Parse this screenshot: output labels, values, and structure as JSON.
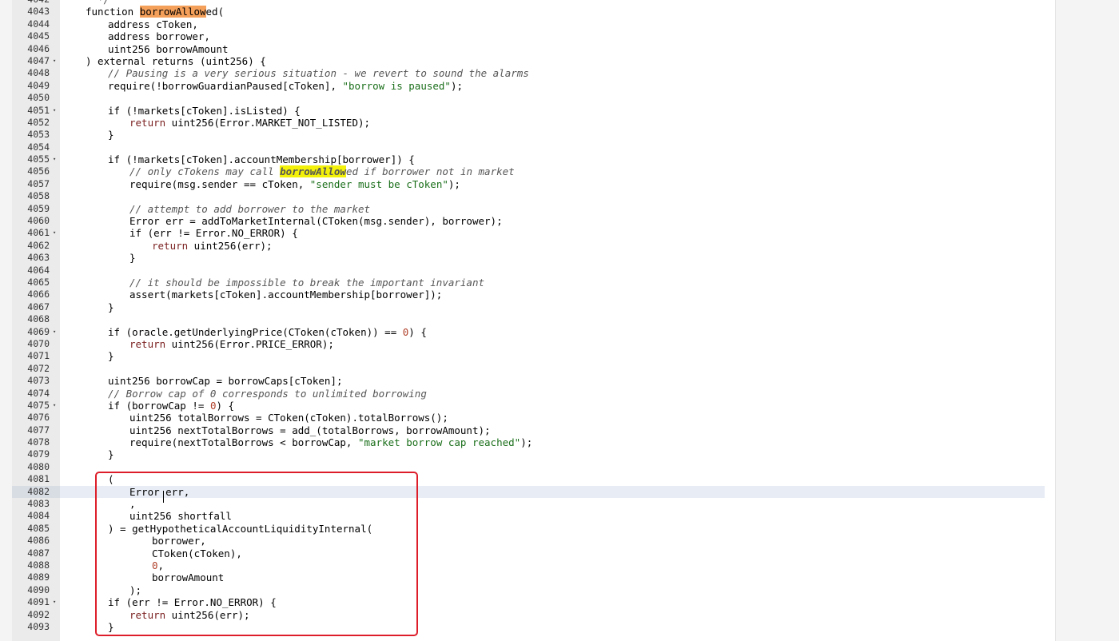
{
  "editor": {
    "highlight_colors": {
      "orange": "#f5a05a",
      "yellow": "#f3f10a",
      "annotation_box": "#dd1e2a",
      "active_line": "#e8edf5"
    },
    "active_line_number": "4082",
    "lines": [
      {
        "n": "4042",
        "fold": false,
        "indent": 0,
        "tokens": [
          {
            "t": "  */",
            "c": "comment"
          }
        ]
      },
      {
        "n": "4043",
        "fold": false,
        "indent": 0,
        "tokens": [
          {
            "t": "function "
          },
          {
            "t": "borrowAllow",
            "hl": "orange"
          },
          {
            "t": "ed("
          }
        ]
      },
      {
        "n": "4044",
        "fold": false,
        "indent": 1,
        "tokens": [
          {
            "t": "address cToken,"
          }
        ]
      },
      {
        "n": "4045",
        "fold": false,
        "indent": 1,
        "tokens": [
          {
            "t": "address borrower,"
          }
        ]
      },
      {
        "n": "4046",
        "fold": false,
        "indent": 1,
        "tokens": [
          {
            "t": "uint256 borrowAmount"
          }
        ]
      },
      {
        "n": "4047",
        "fold": true,
        "indent": 0,
        "tokens": [
          {
            "t": ") external returns (uint256) {"
          }
        ]
      },
      {
        "n": "4048",
        "fold": false,
        "indent": 1,
        "tokens": [
          {
            "t": "// Pausing is a very serious situation - we revert to sound the alarms",
            "c": "comment"
          }
        ]
      },
      {
        "n": "4049",
        "fold": false,
        "indent": 1,
        "tokens": [
          {
            "t": "require(!borrowGuardianPaused[cToken], "
          },
          {
            "t": "\"borrow is paused\"",
            "c": "string"
          },
          {
            "t": ");"
          }
        ]
      },
      {
        "n": "4050",
        "fold": false,
        "indent": 0,
        "tokens": []
      },
      {
        "n": "4051",
        "fold": true,
        "indent": 1,
        "tokens": [
          {
            "t": "if (!markets[cToken].isListed) {"
          }
        ]
      },
      {
        "n": "4052",
        "fold": false,
        "indent": 2,
        "tokens": [
          {
            "t": "return",
            "c": "kw"
          },
          {
            "t": " uint256(Error.MARKET_NOT_LISTED);"
          }
        ]
      },
      {
        "n": "4053",
        "fold": false,
        "indent": 1,
        "tokens": [
          {
            "t": "}"
          }
        ]
      },
      {
        "n": "4054",
        "fold": false,
        "indent": 0,
        "tokens": []
      },
      {
        "n": "4055",
        "fold": true,
        "indent": 1,
        "tokens": [
          {
            "t": "if (!markets[cToken].accountMembership[borrower]) {"
          }
        ]
      },
      {
        "n": "4056",
        "fold": false,
        "indent": 2,
        "tokens": [
          {
            "t": "// only cTokens may call ",
            "c": "comment"
          },
          {
            "t": "borrowAllow",
            "hl": "yellow",
            "c": "comment"
          },
          {
            "t": "ed if borrower not in market",
            "c": "comment"
          }
        ]
      },
      {
        "n": "4057",
        "fold": false,
        "indent": 2,
        "tokens": [
          {
            "t": "require(msg.sender == cToken, "
          },
          {
            "t": "\"sender must be cToken\"",
            "c": "string"
          },
          {
            "t": ");"
          }
        ]
      },
      {
        "n": "4058",
        "fold": false,
        "indent": 0,
        "tokens": []
      },
      {
        "n": "4059",
        "fold": false,
        "indent": 2,
        "tokens": [
          {
            "t": "// attempt to add borrower to the market",
            "c": "comment"
          }
        ]
      },
      {
        "n": "4060",
        "fold": false,
        "indent": 2,
        "tokens": [
          {
            "t": "Error err = addToMarketInternal(CToken(msg.sender), borrower);"
          }
        ]
      },
      {
        "n": "4061",
        "fold": true,
        "indent": 2,
        "tokens": [
          {
            "t": "if (err != Error.NO_ERROR) {"
          }
        ]
      },
      {
        "n": "4062",
        "fold": false,
        "indent": 3,
        "tokens": [
          {
            "t": "return",
            "c": "kw"
          },
          {
            "t": " uint256(err);"
          }
        ]
      },
      {
        "n": "4063",
        "fold": false,
        "indent": 2,
        "tokens": [
          {
            "t": "}"
          }
        ]
      },
      {
        "n": "4064",
        "fold": false,
        "indent": 0,
        "tokens": []
      },
      {
        "n": "4065",
        "fold": false,
        "indent": 2,
        "tokens": [
          {
            "t": "// it should be impossible to break the important invariant",
            "c": "comment"
          }
        ]
      },
      {
        "n": "4066",
        "fold": false,
        "indent": 2,
        "tokens": [
          {
            "t": "assert(markets[cToken].accountMembership[borrower]);"
          }
        ]
      },
      {
        "n": "4067",
        "fold": false,
        "indent": 1,
        "tokens": [
          {
            "t": "}"
          }
        ]
      },
      {
        "n": "4068",
        "fold": false,
        "indent": 0,
        "tokens": []
      },
      {
        "n": "4069",
        "fold": true,
        "indent": 1,
        "tokens": [
          {
            "t": "if (oracle.getUnderlyingPrice(CToken(cToken)) == "
          },
          {
            "t": "0",
            "c": "num"
          },
          {
            "t": ") {"
          }
        ]
      },
      {
        "n": "4070",
        "fold": false,
        "indent": 2,
        "tokens": [
          {
            "t": "return",
            "c": "kw"
          },
          {
            "t": " uint256(Error.PRICE_ERROR);"
          }
        ]
      },
      {
        "n": "4071",
        "fold": false,
        "indent": 1,
        "tokens": [
          {
            "t": "}"
          }
        ]
      },
      {
        "n": "4072",
        "fold": false,
        "indent": 0,
        "tokens": []
      },
      {
        "n": "4073",
        "fold": false,
        "indent": 1,
        "tokens": [
          {
            "t": "uint256 borrowCap = borrowCaps[cToken];"
          }
        ]
      },
      {
        "n": "4074",
        "fold": false,
        "indent": 1,
        "tokens": [
          {
            "t": "// Borrow cap of 0 corresponds to unlimited borrowing",
            "c": "comment"
          }
        ]
      },
      {
        "n": "4075",
        "fold": true,
        "indent": 1,
        "tokens": [
          {
            "t": "if (borrowCap != "
          },
          {
            "t": "0",
            "c": "num"
          },
          {
            "t": ") {"
          }
        ]
      },
      {
        "n": "4076",
        "fold": false,
        "indent": 2,
        "tokens": [
          {
            "t": "uint256 totalBorrows = CToken(cToken).totalBorrows();"
          }
        ]
      },
      {
        "n": "4077",
        "fold": false,
        "indent": 2,
        "tokens": [
          {
            "t": "uint256 nextTotalBorrows = add_(totalBorrows, borrowAmount);"
          }
        ]
      },
      {
        "n": "4078",
        "fold": false,
        "indent": 2,
        "tokens": [
          {
            "t": "require(nextTotalBorrows < borrowCap, "
          },
          {
            "t": "\"market borrow cap reached\"",
            "c": "string"
          },
          {
            "t": ");"
          }
        ]
      },
      {
        "n": "4079",
        "fold": false,
        "indent": 1,
        "tokens": [
          {
            "t": "}"
          }
        ]
      },
      {
        "n": "4080",
        "fold": false,
        "indent": 0,
        "tokens": []
      },
      {
        "n": "4081",
        "fold": false,
        "indent": 1,
        "tokens": [
          {
            "t": "("
          }
        ]
      },
      {
        "n": "4082",
        "fold": false,
        "indent": 2,
        "tokens": [
          {
            "t": "Error err,"
          }
        ]
      },
      {
        "n": "4083",
        "fold": false,
        "indent": 2,
        "tokens": [
          {
            "t": ","
          }
        ]
      },
      {
        "n": "4084",
        "fold": false,
        "indent": 2,
        "tokens": [
          {
            "t": "uint256 shortfall"
          }
        ]
      },
      {
        "n": "4085",
        "fold": false,
        "indent": 1,
        "tokens": [
          {
            "t": ") = getHypotheticalAccountLiquidityInternal("
          }
        ]
      },
      {
        "n": "4086",
        "fold": false,
        "indent": 3,
        "tokens": [
          {
            "t": "borrower,"
          }
        ]
      },
      {
        "n": "4087",
        "fold": false,
        "indent": 3,
        "tokens": [
          {
            "t": "CToken(cToken),"
          }
        ]
      },
      {
        "n": "4088",
        "fold": false,
        "indent": 3,
        "tokens": [
          {
            "t": "0",
            "c": "num"
          },
          {
            "t": ","
          }
        ]
      },
      {
        "n": "4089",
        "fold": false,
        "indent": 3,
        "tokens": [
          {
            "t": "borrowAmount"
          }
        ]
      },
      {
        "n": "4090",
        "fold": false,
        "indent": 2,
        "tokens": [
          {
            "t": ");"
          }
        ]
      },
      {
        "n": "4091",
        "fold": true,
        "indent": 1,
        "tokens": [
          {
            "t": "if (err != Error.NO_ERROR) {"
          }
        ]
      },
      {
        "n": "4092",
        "fold": false,
        "indent": 2,
        "tokens": [
          {
            "t": "return",
            "c": "kw"
          },
          {
            "t": " uint256(err);"
          }
        ]
      },
      {
        "n": "4093",
        "fold": false,
        "indent": 1,
        "tokens": [
          {
            "t": "}"
          }
        ]
      }
    ]
  }
}
